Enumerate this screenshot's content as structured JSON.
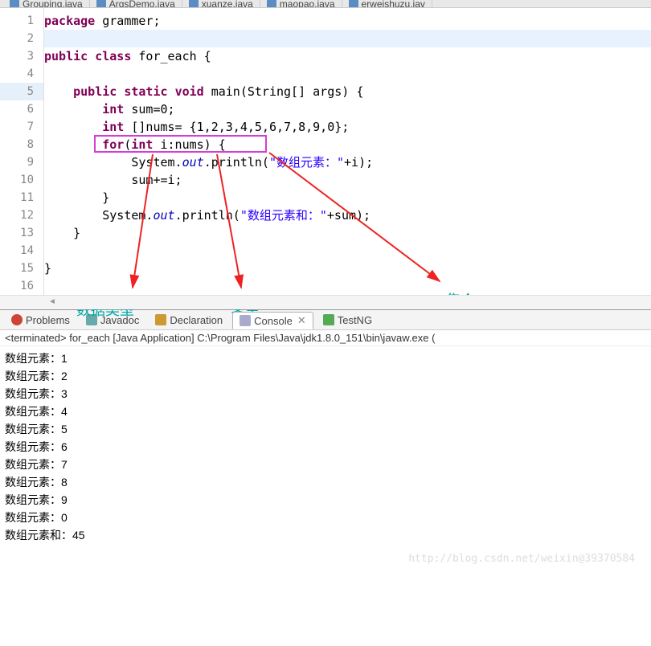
{
  "file_tabs": [
    {
      "label": "Grouping.java"
    },
    {
      "label": "ArgsDemo.java"
    },
    {
      "label": "xuanze.java"
    },
    {
      "label": "maopao.java"
    },
    {
      "label": "erweishuzu.jav"
    }
  ],
  "gutter": {
    "lines": [
      "1",
      "2",
      "3",
      "4",
      "5",
      "6",
      "7",
      "8",
      "9",
      "10",
      "11",
      "12",
      "13",
      "14",
      "15",
      "16"
    ],
    "marked_index": 4
  },
  "code": {
    "l1": {
      "kw": "package",
      "rest": " grammer;"
    },
    "l3": {
      "kw1": "public",
      "kw2": "class",
      "name": " for_each {"
    },
    "l5": {
      "indent": "    ",
      "kw1": "public",
      "kw2": "static",
      "kw3": "void",
      "sig": " main(String[] args) {"
    },
    "l6": {
      "indent": "        ",
      "kw": "int",
      "rest": " sum=0;"
    },
    "l7": {
      "indent": "        ",
      "kw": "int",
      "rest": " []nums= {1,2,3,4,5,6,7,8,9,0};"
    },
    "l8": {
      "indent": "        ",
      "kw1": "for",
      "paren_open": "(",
      "kw2": "int",
      "rest": " i:nums) {"
    },
    "l9": {
      "indent": "            ",
      "sys": "System.",
      "out": "out",
      "print": ".println(",
      "str": "\"数组元素：\"",
      "tail": "+i);"
    },
    "l10": {
      "indent": "            ",
      "rest": "sum+=i;"
    },
    "l11": {
      "indent": "        }",
      "rest": ""
    },
    "l12": {
      "indent": "        ",
      "sys": "System.",
      "out": "out",
      "print": ".println(",
      "str": "\"数组元素和：\"",
      "tail": "+sum);"
    },
    "l13": {
      "indent": "    }",
      "rest": ""
    },
    "l15": "}"
  },
  "annotations": {
    "a1": "数据类型",
    "a2": "变量",
    "a3": "集合"
  },
  "panel": {
    "tabs": [
      {
        "label": "Problems",
        "icon": "problems"
      },
      {
        "label": "Javadoc",
        "icon": "javadoc"
      },
      {
        "label": "Declaration",
        "icon": "decl"
      },
      {
        "label": "Console",
        "icon": "console",
        "active": true
      },
      {
        "label": "TestNG",
        "icon": "testng"
      }
    ],
    "terminated": "<terminated> for_each [Java Application] C:\\Program Files\\Java\\jdk1.8.0_151\\bin\\javaw.exe (",
    "output": [
      "数组元素：1",
      "数组元素：2",
      "数组元素：3",
      "数组元素：4",
      "数组元素：5",
      "数组元素：6",
      "数组元素：7",
      "数组元素：8",
      "数组元素：9",
      "数组元素：0",
      "数组元素和：45"
    ]
  },
  "watermark": "http://blog.csdn.net/weixin@39370584"
}
